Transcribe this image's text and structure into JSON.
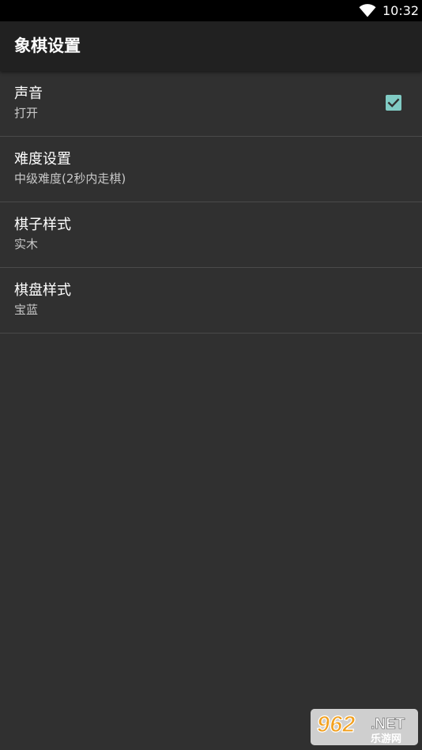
{
  "status_bar": {
    "time": "10:32",
    "wifi_icon": "wifi-full-icon"
  },
  "app_bar": {
    "title": "象棋设置"
  },
  "preferences": [
    {
      "title": "声音",
      "summary": "打开",
      "checked": true
    },
    {
      "title": "难度设置",
      "summary": "中级难度(2秒内走棋)"
    },
    {
      "title": "棋子样式",
      "summary": "实木"
    },
    {
      "title": "棋盘样式",
      "summary": "宝蓝"
    }
  ],
  "watermark": {
    "logo": "962.NET",
    "name": "乐游网"
  },
  "colors": {
    "background": "#303030",
    "app_bar": "#212121",
    "accent": "#80cbc4",
    "divider": "#4a4a4a",
    "summary_text": "#c8c8c8"
  }
}
